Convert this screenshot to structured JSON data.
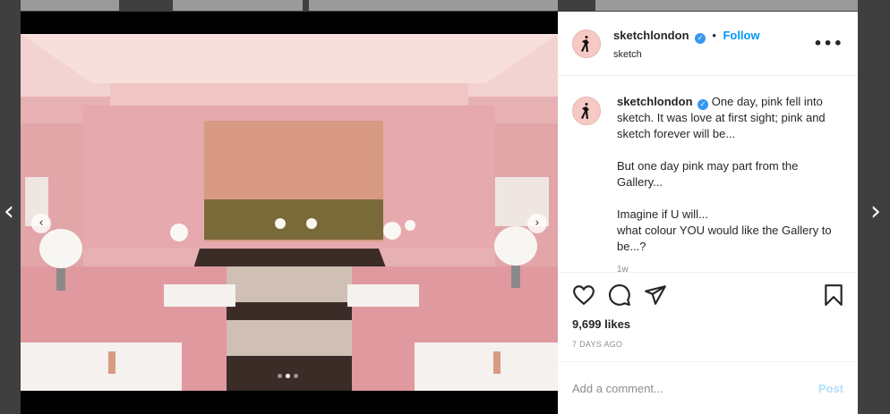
{
  "post": {
    "username": "sketchlondon",
    "verified_icon": "verified-badge-icon",
    "separator": "•",
    "follow_label": "Follow",
    "location": "sketch",
    "more_label": "•••",
    "caption": {
      "username": "sketchlondon",
      "line1": "One day, pink fell into sketch. It was love at first sight; pink and sketch forever will be...",
      "line2": "But one day pink may part from the Gallery...",
      "line3": "Imagine if U will...",
      "line4": "what colour YOU would like the Gallery to be...?",
      "age": "1w"
    },
    "likes": "9,699 likes",
    "date": "7 DAYS AGO",
    "comment_placeholder": "Add a comment...",
    "post_label": "Post"
  },
  "carousel": {
    "prev_label": "‹",
    "next_label": "›",
    "slide_count": 3,
    "active_slide": 2
  },
  "modal_nav": {
    "prev_label": "‹",
    "next_label": "›"
  },
  "colors": {
    "accent": "#0095f6",
    "post_disabled": "#b2dffc",
    "room_pink": "#e9b3b4",
    "copper": "#d99a82"
  }
}
